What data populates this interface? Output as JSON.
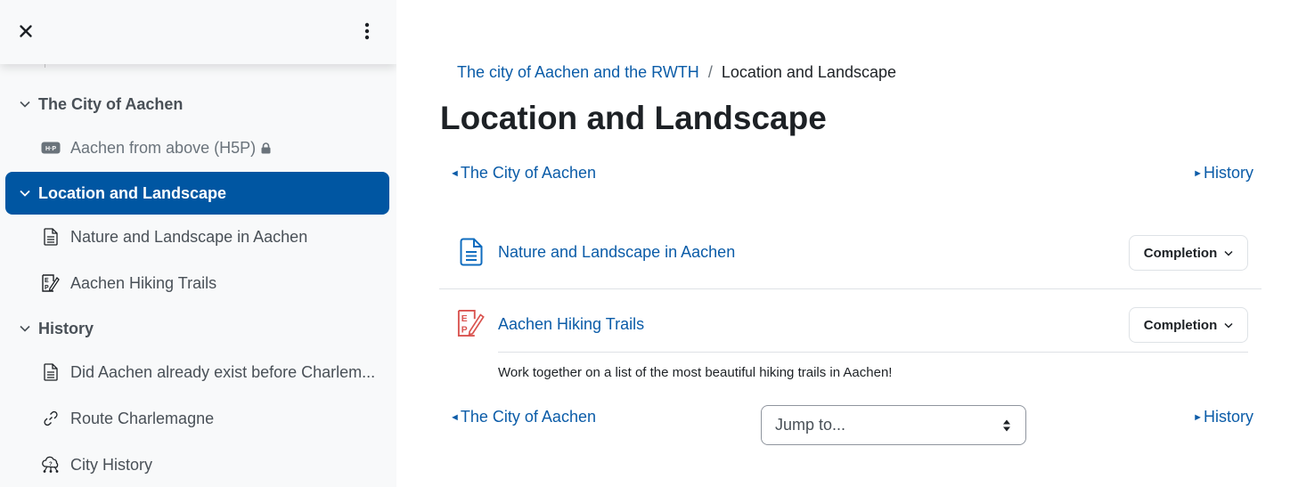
{
  "drawer": {
    "close_icon": "close-icon",
    "menu_icon": "kebab-menu-icon",
    "sections": [
      {
        "title": "The City of Aachen",
        "expanded": true,
        "active": false,
        "items": [
          {
            "label": "Aachen from above (H5P)",
            "icon": "h5p-icon",
            "locked": true
          }
        ]
      },
      {
        "title": "Location and Landscape",
        "expanded": true,
        "active": true,
        "items": [
          {
            "label": "Nature and Landscape in Aachen",
            "icon": "page-icon",
            "locked": false
          },
          {
            "label": "Aachen Hiking Trails",
            "icon": "etherpad-icon",
            "locked": false
          }
        ]
      },
      {
        "title": "History",
        "expanded": true,
        "active": false,
        "items": [
          {
            "label": "Did Aachen already exist before Charlem...",
            "icon": "page-icon",
            "locked": false
          },
          {
            "label": "Route Charlemagne",
            "icon": "link-icon",
            "locked": false
          },
          {
            "label": "City History",
            "icon": "mindmap-icon",
            "locked": false
          }
        ]
      }
    ]
  },
  "breadcrumb": {
    "parent": "The city of Aachen and the RWTH",
    "separator": "/",
    "current": "Location and Landscape"
  },
  "page": {
    "title": "Location and Landscape",
    "prev_link": "The City of Aachen",
    "next_link": "History",
    "prev_arrow": "◄",
    "next_arrow": "►",
    "activities": [
      {
        "title": "Nature and Landscape in Aachen",
        "icon": "page-icon",
        "completion_label": "Completion",
        "description": ""
      },
      {
        "title": "Aachen Hiking Trails",
        "icon": "etherpad-icon",
        "completion_label": "Completion",
        "description": "Work together on a list of the most beautiful hiking trails in Aachen!"
      }
    ],
    "jump_to": {
      "selected": "Jump to..."
    }
  },
  "colors": {
    "accent": "#0056a2",
    "link": "#0b5ca8",
    "page_icon": "#0f6cbf",
    "etherpad_icon": "#d9534f"
  }
}
